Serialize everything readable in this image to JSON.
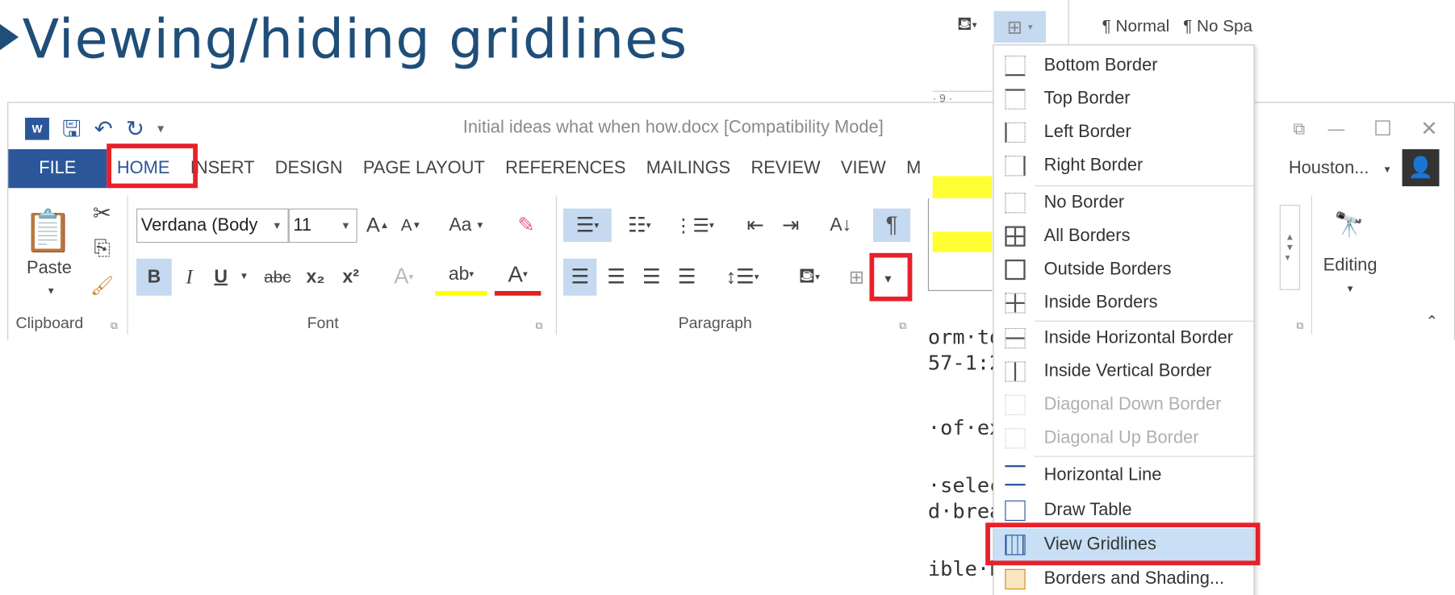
{
  "slide": {
    "title": "Viewing/hiding gridlines"
  },
  "window": {
    "doc_title": "Initial ideas what when how.docx [Compatibility Mode]",
    "word_logo": "W",
    "user": "Houston...",
    "controls": [
      "⧉",
      "—",
      "☐",
      "✕"
    ]
  },
  "tabs": [
    {
      "label": "FILE"
    },
    {
      "label": "HOME"
    },
    {
      "label": "INSERT"
    },
    {
      "label": "DESIGN"
    },
    {
      "label": "PAGE LAYOUT"
    },
    {
      "label": "REFERENCES"
    },
    {
      "label": "MAILINGS"
    },
    {
      "label": "REVIEW"
    },
    {
      "label": "VIEW"
    },
    {
      "label": "M"
    }
  ],
  "ribbon": {
    "clipboard": {
      "paste": "Paste",
      "label": "Clipboard"
    },
    "font": {
      "name": "Verdana (Body",
      "size": "11",
      "change_case": "Aa",
      "label": "Font",
      "bold": "B",
      "italic": "I",
      "underline": "U",
      "strike": "abc",
      "subscript": "x₂",
      "superscript": "x²"
    },
    "paragraph": {
      "label": "Paragraph"
    },
    "editing": {
      "label": "Editing"
    }
  },
  "topbar": {
    "styles": [
      "¶ Normal",
      "¶ No Spa"
    ],
    "ruler": "· 9 ·"
  },
  "doc_fragments": [
    "orm·to",
    "57-1:2",
    "·of·ex",
    "·selec",
    "d·brea",
    "ible·b"
  ],
  "border_menu": {
    "items": [
      {
        "label": "Bottom Border"
      },
      {
        "label": "Top Border"
      },
      {
        "label": "Left Border"
      },
      {
        "label": "Right Border"
      },
      {
        "label": "No Border"
      },
      {
        "label": "All Borders"
      },
      {
        "label": "Outside Borders"
      },
      {
        "label": "Inside Borders"
      },
      {
        "label": "Inside Horizontal Border"
      },
      {
        "label": "Inside Vertical Border"
      },
      {
        "label": "Diagonal Down Border"
      },
      {
        "label": "Diagonal Up Border"
      },
      {
        "label": "Horizontal Line"
      },
      {
        "label": "Draw Table"
      },
      {
        "label": "View Gridlines"
      },
      {
        "label": "Borders and Shading..."
      }
    ]
  },
  "colors": {
    "accent": "#2b579a",
    "highlight_box": "#e8202a",
    "title": "#1f4e79",
    "menu_hover": "#c8dff5"
  }
}
